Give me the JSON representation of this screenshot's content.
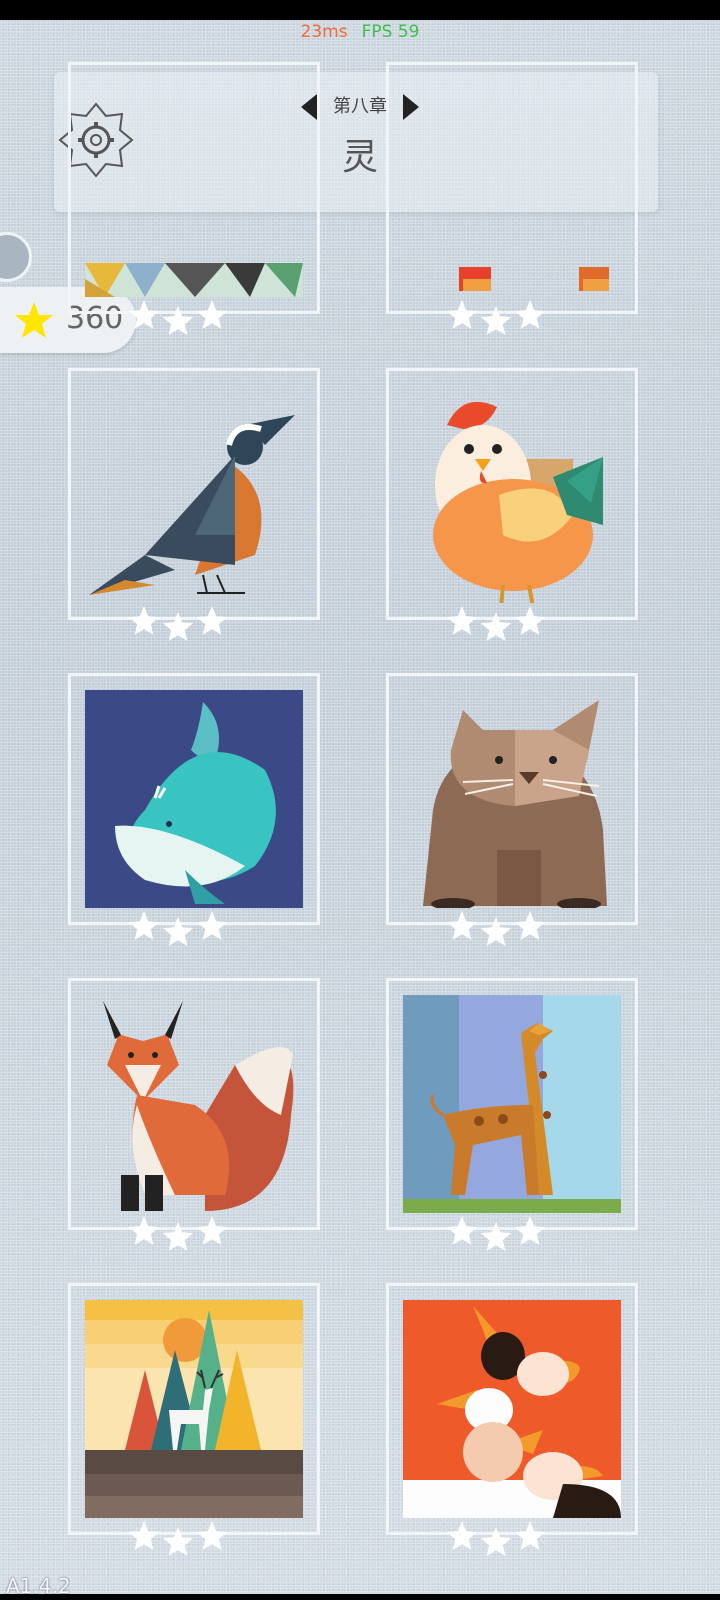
{
  "perf": {
    "ms": "23ms",
    "fps": "FPS 59"
  },
  "header": {
    "chapter": "第八章",
    "title": "灵"
  },
  "stars_total": "360",
  "version": "A1.4.2",
  "colors": {
    "star_fill": "#ffe600",
    "star_empty": "#ffffff",
    "card_border": "#f2f5f7"
  },
  "levels": [
    {
      "name": "level-mosaic",
      "stars_earned": 0
    },
    {
      "name": "level-robin",
      "stars_earned": 0
    },
    {
      "name": "level-bird",
      "stars_earned": 0
    },
    {
      "name": "level-chicken",
      "stars_earned": 0
    },
    {
      "name": "level-whale",
      "stars_earned": 0
    },
    {
      "name": "level-wombat",
      "stars_earned": 0
    },
    {
      "name": "level-fox",
      "stars_earned": 0
    },
    {
      "name": "level-giraffe",
      "stars_earned": 0
    },
    {
      "name": "level-deer",
      "stars_earned": 0
    },
    {
      "name": "level-geese",
      "stars_earned": 0
    }
  ]
}
